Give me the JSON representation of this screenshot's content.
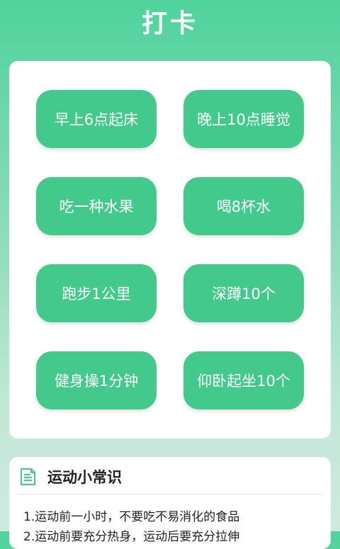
{
  "page": {
    "title": "打卡"
  },
  "tasks": [
    {
      "label": "早上6点起床"
    },
    {
      "label": "晚上10点睡觉"
    },
    {
      "label": "吃一种水果"
    },
    {
      "label": "喝8杯水"
    },
    {
      "label": "跑步1公里"
    },
    {
      "label": "深蹲10个"
    },
    {
      "label": "健身操1分钟"
    },
    {
      "label": "仰卧起坐10个"
    }
  ],
  "tips": {
    "icon": "document-icon",
    "title": "运动小常识",
    "items": [
      "1.运动前一小时，不要吃不易消化的食品",
      "2.运动前要充分热身，运动后要充分拉伸"
    ]
  },
  "colors": {
    "accent": "#43c98c",
    "background_top": "#4fd39b",
    "background_bottom": "#cfe9df"
  }
}
